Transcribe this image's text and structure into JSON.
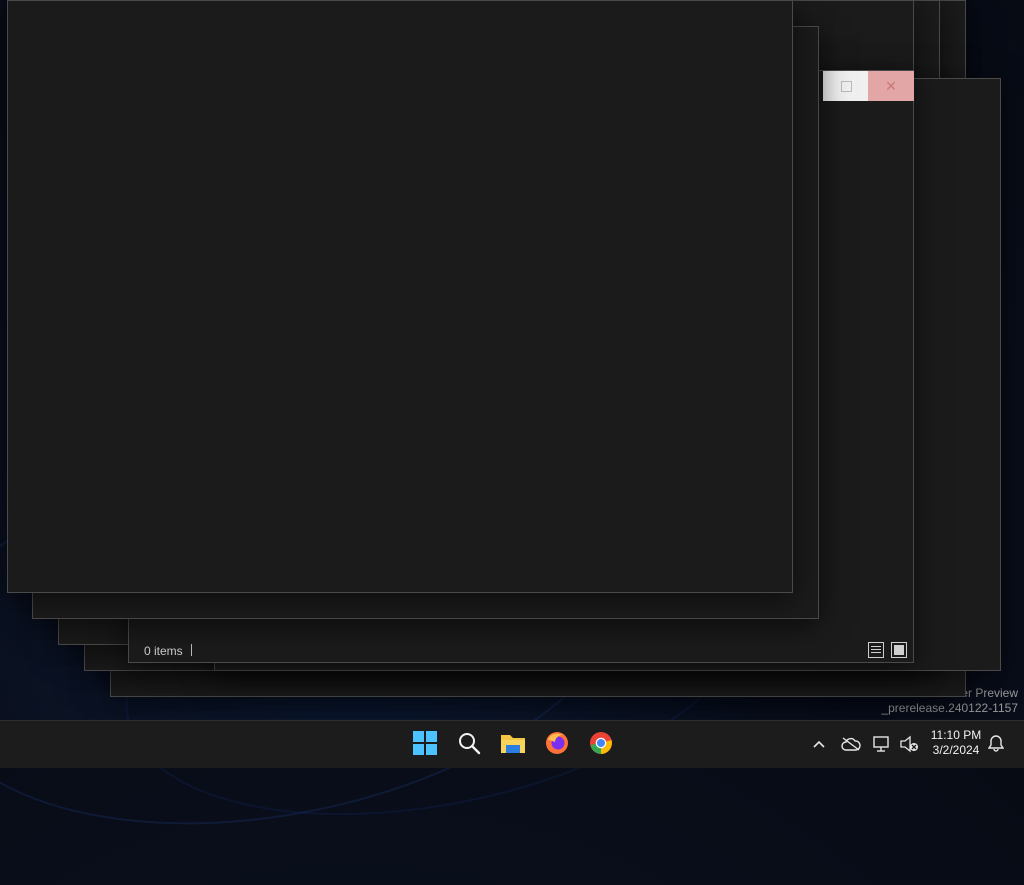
{
  "desktop": {
    "watermark": {
      "line1": "Insider Preview",
      "line2": "_prerelease.240122-1157"
    }
  },
  "explorer_window": {
    "status_text": "0 items",
    "window_buttons": {
      "maximize_icon": "maximize-icon",
      "close_icon": "close-icon"
    },
    "view_buttons": [
      "details-view-icon",
      "tiles-view-icon"
    ]
  },
  "taskbar": {
    "apps": [
      "start-icon",
      "search-icon",
      "file-explorer-icon",
      "firefox-icon",
      "chrome-icon"
    ],
    "tray": [
      "chevron-up-icon",
      "cloud-offline-icon",
      "network-icon",
      "volume-muted-icon"
    ],
    "time": "11:10 PM",
    "date": "3/2/2024",
    "notification_icon": "bell-icon",
    "colors": {
      "start_blue": "#4cc2ff",
      "folder_yellow": "#f4c542",
      "firefox_orange": "#ff7139",
      "chrome_red": "#ea4335",
      "chrome_yellow": "#fbbc05",
      "chrome_green": "#34a853",
      "chrome_blue": "#4285f4"
    }
  }
}
